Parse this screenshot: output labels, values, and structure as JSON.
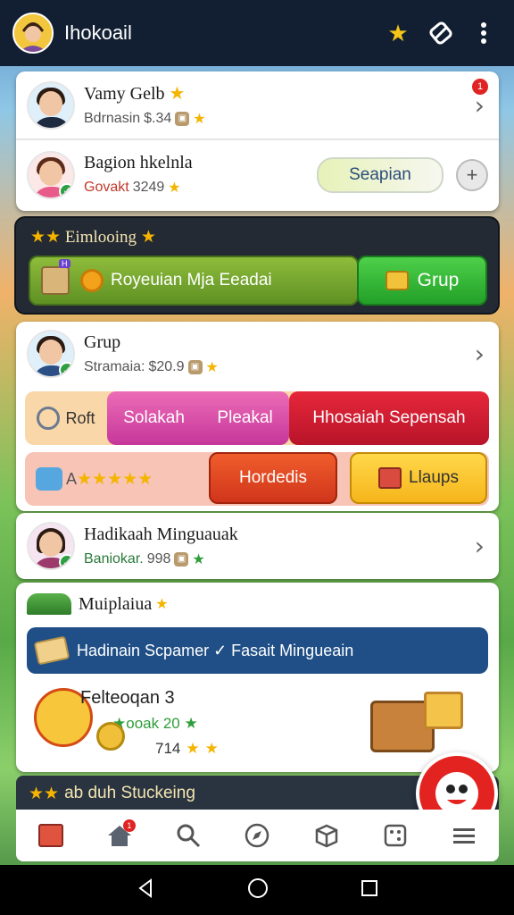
{
  "topbar": {
    "title": "Ihokoail",
    "star_icon": "star-icon",
    "sticker_icon": "sticker-icon",
    "menu_icon": "more-vert-icon"
  },
  "friends": [
    {
      "name": "Vamy Gelb",
      "status": "Bdrnasin",
      "score": "$.34",
      "badge": "1"
    },
    {
      "name": "Bagion hkelnla",
      "status": "Govakt",
      "score": "3249",
      "button": "Seapian"
    }
  ],
  "event": {
    "title": "Eimlooing",
    "badge": "H",
    "bar_label": "Royeuian Mja Eeadai",
    "group_button": "Grup"
  },
  "group": {
    "name": "Grup",
    "status": "Stramaia:",
    "score": "$20.9",
    "tabs": {
      "roll": "Roft",
      "a": "Solakah",
      "b": "Pleakal",
      "c": "Hhosaiah Sepensah"
    },
    "rating_prefix": "A",
    "rating": 5,
    "btn_red": "Hordedis",
    "btn_yellow": "Llaups"
  },
  "friend3": {
    "name": "Hadikaah Minguauak",
    "status": "Baniokar.",
    "score": "998"
  },
  "multi": {
    "title": "Muiplaiua",
    "banner": "Hadinain Scpamer ✓ Fasait Mingueain",
    "reward_title": "Felteoqan 3",
    "reward_stars": "★ooak 20 ★",
    "reward_coins": "714"
  },
  "bottom_banner": "ab duh Stuckeing",
  "nav_badge": "1"
}
